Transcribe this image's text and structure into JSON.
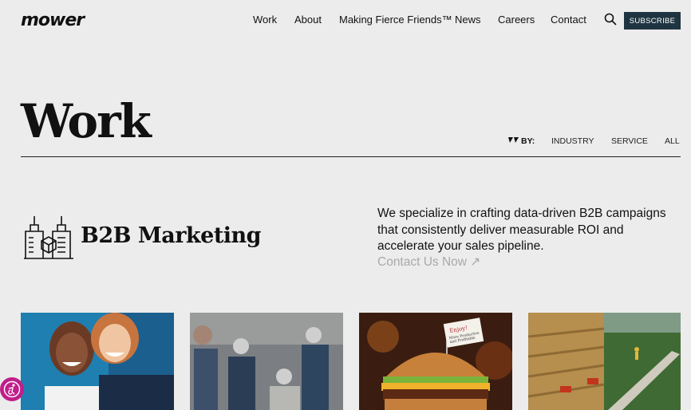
{
  "header": {
    "logo_alt": "mower",
    "nav": [
      {
        "label": "Work"
      },
      {
        "label": "About"
      },
      {
        "label": "Making Fierce Friends™"
      },
      {
        "label": "News"
      },
      {
        "label": "Careers"
      },
      {
        "label": "Contact"
      }
    ],
    "search_icon": "search-icon",
    "subscribe_label": "SUBSCRIBE",
    "subscribe_color": "#1f3441"
  },
  "page": {
    "title": "Work",
    "filter_label": "BY:",
    "filters": [
      "INDUSTRY",
      "SERVICE",
      "ALL"
    ]
  },
  "category": {
    "icon": "b2b-buildings-icon",
    "title": "B2B Marketing",
    "description": "We specialize in crafting data-driven B2B campaigns that consistently deliver measurable ROI and accelerate your sales pipeline.",
    "cta": "Contact Us Now ↗",
    "cta_color": "#a9a9a9"
  },
  "thumbnails": [
    {
      "subject": "two laughing women"
    },
    {
      "subject": "workers in hard hats"
    },
    {
      "subject": "burger with flag",
      "flag_text": [
        "Enjoy!",
        "More Productive",
        "and Profitable"
      ]
    },
    {
      "subject": "mine and trail split image"
    }
  ],
  "accessibility": {
    "icon": "accessibility-icon",
    "color": "#c01e8a"
  }
}
